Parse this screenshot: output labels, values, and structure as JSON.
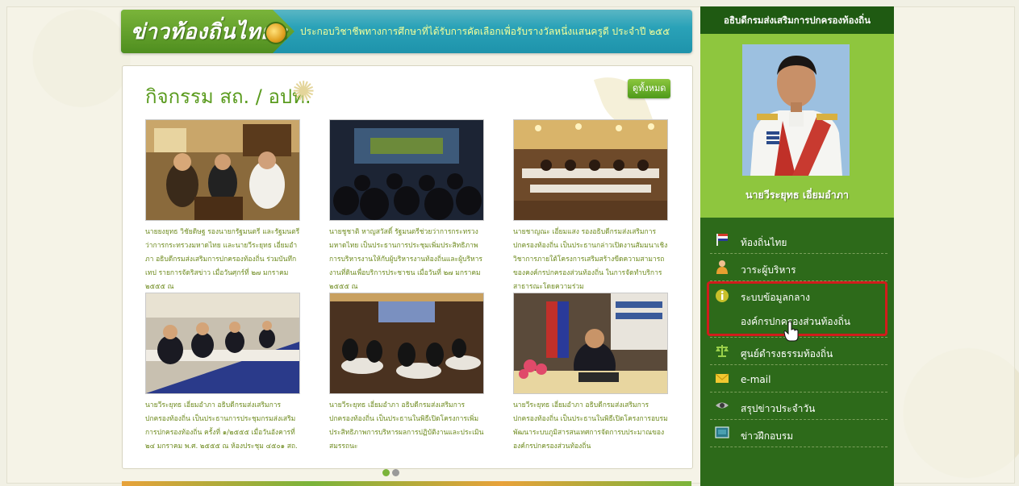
{
  "banner": {
    "title": "ข่าวท้องถิ่นไทย :",
    "ticker": "ประกอบวิชาชีพทางการศึกษาที่ได้รับการคัดเลือกเพื่อรับรางวัลหนึ่งแสนครูดี ประจำปี ๒๕๕"
  },
  "panel": {
    "title": "กิจกรรม สถ. / อปท.",
    "see_all": "ดูทั้งหมด"
  },
  "news": [
    {
      "caption": "นายยงยุทธ วิชัยดิษฐ รองนายกรัฐมนตรี และรัฐมนตรีว่าการกระทรวงมหาดไทย และนายวีระยุทธ เอี่ยมอำภา อธิบดีกรมส่งเสริมการปกครองท้องถิ่น ร่วมบันทึกเทป รายการจัดริสข่าว เมื่อวันศุกร์ที่ ๒๗ มกราคม ๒๕๕๕ ณ"
    },
    {
      "caption": "นายชูชาติ หาญสวัสดิ์ รัฐมนตรีช่วยว่าการกระทรวงมหาดไทย เป็นประธานการประชุมเพิ่มประสิทธิภาพการบริหารงานให้กับผู้บริหารงานท้องถิ่นและผู้บริหารงานที่ดินเพื่อบริการประชาชน เมื่อวันที่ ๒๗ มกราคม ๒๕๕๕ ณ"
    },
    {
      "caption": "นายชาญณะ เอี่ยมแสง รองอธิบดีกรมส่งเสริมการปกครองท้องถิ่น เป็นประธานกล่าวเปิดงานสัมมนาเชิงวิชาการภายใต้โครงการเสริมสร้างขีดความสามารถของคงค์กรปกครองส่วนท้องถิ่น ในการจัดทำบริการสาธารณะโดยความร่วม"
    },
    {
      "caption": "นายวีระยุทธ เอี่ยมอำภา อธิบดีกรมส่งเสริมการปกครองท้องถิ่น เป็นประธานการประชุมกรมส่งเสริมการปกครองท้องถิ่น ครั้งที่ ๑/๒๕๕๕ เมื่อวันอังคารที่ ๒๔ มกราคม พ.ศ. ๒๕๕๕ ณ ห้องประชุม ๔๕๐๑ สถ."
    },
    {
      "caption": "นายวีระยุทธ เอี่ยมอำภา อธิบดีกรมส่งเสริมการปกครองท้องถิ่น เป็นประธานในพิธีเปิดโครงการเพิ่มประสิทธิภาพการบริหารผลการปฏิบัติงานและประเมินสมรรถนะ"
    },
    {
      "caption": "นายวีระยุทธ เอี่ยมอำภา อธิบดีกรมส่งเสริมการปกครองท้องถิ่น เป็นประธานในพิธีเปิดโครงการอบรมพัฒนาระบบภูมิสารสนเทศการจัดการบประมาณขององค์กรปกครองส่วนท้องถิ่น"
    }
  ],
  "pager": {
    "active": 1,
    "total": 2
  },
  "sidebar": {
    "header": "อธิบดีกรมส่งเสริมการปกครองท้องถิ่น",
    "director_name": "นายวีระยุทธ เอี่ยมอำภา",
    "menu": [
      {
        "label": "ท้องถิ่นไทย",
        "icon": "flag-icon"
      },
      {
        "label": "วาระผู้บริหาร",
        "icon": "person-icon"
      },
      {
        "label": "ระบบข้อมูลกลาง",
        "label2": "องค์กรปกครองส่วนท้องถิ่น",
        "icon": "info-icon"
      },
      {
        "label": "ศูนย์ดำรงธรรมท้องถิ่น",
        "icon": "scales-icon"
      },
      {
        "label": "e-mail",
        "icon": "envelope-icon"
      },
      {
        "label": "สรุปข่าวประจำวัน",
        "icon": "eye-icon"
      },
      {
        "label": "ข่าวฝึกอบรม",
        "icon": "board-icon"
      }
    ]
  },
  "colors": {
    "accent_green": "#5a9b1e",
    "caption_green": "#6d8a1d",
    "sidebar_dark": "#2d6a1a",
    "sidebar_light": "#8ec63e",
    "banner_blue": "#2aa2b8",
    "highlight_red": "#d11c1c"
  }
}
